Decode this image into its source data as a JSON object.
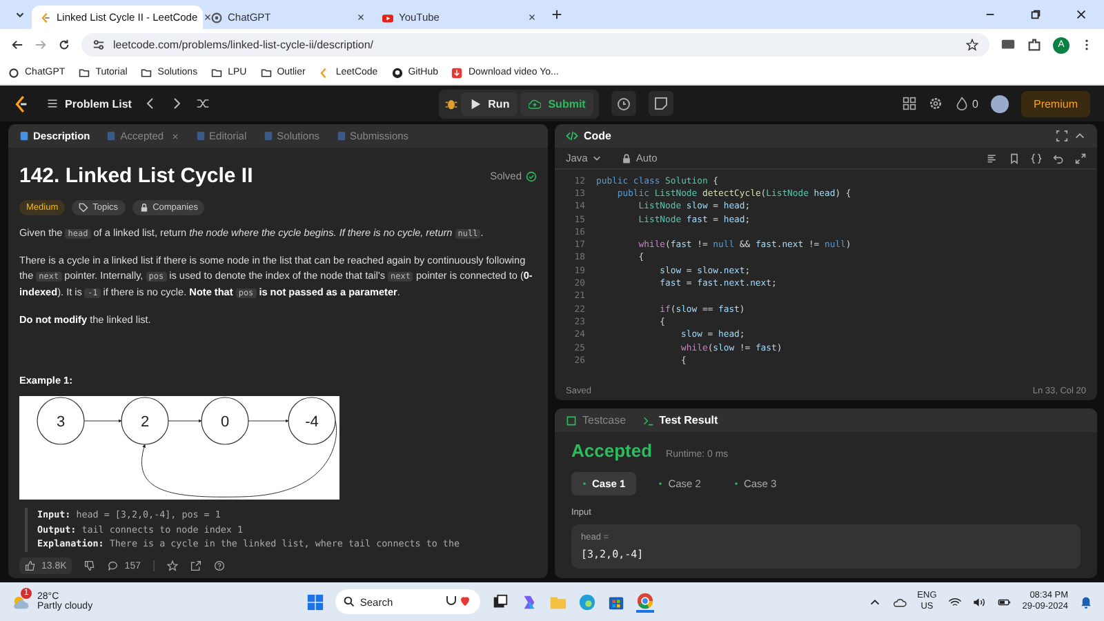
{
  "browser": {
    "tabs": [
      {
        "title": "Linked List Cycle II - LeetCode",
        "kind": "leetcode",
        "selected": true
      },
      {
        "title": "ChatGPT",
        "kind": "chatgpt",
        "selected": false
      },
      {
        "title": "YouTube",
        "kind": "youtube",
        "selected": false
      }
    ],
    "url": "leetcode.com/problems/linked-list-cycle-ii/description/",
    "profile_initial": "A",
    "bookmarks": [
      {
        "label": "ChatGPT",
        "kind": "chatgpt"
      },
      {
        "label": "Tutorial",
        "kind": "folder"
      },
      {
        "label": "Solutions",
        "kind": "folder"
      },
      {
        "label": "LPU",
        "kind": "folder"
      },
      {
        "label": "Outlier",
        "kind": "folder"
      },
      {
        "label": "LeetCode",
        "kind": "leetcode"
      },
      {
        "label": "GitHub",
        "kind": "github"
      },
      {
        "label": "Download video Yo...",
        "kind": "download"
      }
    ]
  },
  "nav": {
    "problem_list": "Problem List",
    "run": "Run",
    "submit": "Submit",
    "streak": "0",
    "premium": "Premium"
  },
  "description_panel": {
    "tabs": [
      {
        "label": "Description",
        "selected": true,
        "closable": false
      },
      {
        "label": "Accepted",
        "selected": false,
        "closable": true
      },
      {
        "label": "Editorial",
        "selected": false,
        "closable": false
      },
      {
        "label": "Solutions",
        "selected": false,
        "closable": false
      },
      {
        "label": "Submissions",
        "selected": false,
        "closable": false
      }
    ],
    "title": "142. Linked List Cycle II",
    "status": "Solved",
    "tags": [
      {
        "label": "Medium",
        "kind": "difficulty"
      },
      {
        "label": "Topics",
        "kind": "topics"
      },
      {
        "label": "Companies",
        "kind": "companies"
      }
    ],
    "paragraphs": [
      [
        {
          "text": "Given the ",
          "kind": "plain"
        },
        {
          "text": "head",
          "kind": "code"
        },
        {
          "text": " of a linked list, return ",
          "kind": "plain"
        },
        {
          "text": "the node where the cycle begins. If there is no cycle, return ",
          "kind": "italic"
        },
        {
          "text": "null",
          "kind": "code"
        },
        {
          "text": ".",
          "kind": "plain"
        }
      ],
      [
        {
          "text": "There is a cycle in a linked list if there is some node in the list that can be reached again by continuously following the ",
          "kind": "plain"
        },
        {
          "text": "next",
          "kind": "code"
        },
        {
          "text": " pointer. Internally, ",
          "kind": "plain"
        },
        {
          "text": "pos",
          "kind": "code"
        },
        {
          "text": " is used to denote the index of the node that tail's ",
          "kind": "plain"
        },
        {
          "text": "next",
          "kind": "code"
        },
        {
          "text": " pointer is connected to (",
          "kind": "plain"
        },
        {
          "text": "0-indexed",
          "kind": "bold"
        },
        {
          "text": "). It is ",
          "kind": "plain"
        },
        {
          "text": "-1",
          "kind": "code"
        },
        {
          "text": " if there is no cycle. ",
          "kind": "plain"
        },
        {
          "text": "Note that ",
          "kind": "bold"
        },
        {
          "text": "pos",
          "kind": "code"
        },
        {
          "text": " is not passed as a parameter",
          "kind": "bold"
        },
        {
          "text": ".",
          "kind": "plain"
        }
      ],
      [
        {
          "text": "Do not modify",
          "kind": "bold"
        },
        {
          "text": " the linked list.",
          "kind": "plain"
        }
      ]
    ],
    "example_title": "Example 1:",
    "diagram": {
      "nodes": [
        "3",
        "2",
        "0",
        "-4"
      ]
    },
    "example_lines": [
      {
        "label": "Input:",
        "text": "head = [3,2,0,-4], pos = 1"
      },
      {
        "label": "Output:",
        "text": "tail connects to node index 1"
      },
      {
        "label": "Explanation:",
        "text": "There is a cycle in the linked list, where tail connects to the"
      }
    ],
    "likes": "13.8K",
    "comments": "157"
  },
  "code_panel": {
    "title": "Code",
    "language": "Java",
    "mode": "Auto",
    "status": "Saved",
    "cursor": "Ln 33, Col 20",
    "lines": [
      {
        "n": "12",
        "tokens": [
          {
            "text": "public class ",
            "kind": "kw"
          },
          {
            "text": "Solution",
            "kind": "type"
          },
          {
            "text": " {",
            "kind": "plain"
          }
        ]
      },
      {
        "n": "13",
        "tokens": [
          {
            "text": "    public ",
            "kind": "kw"
          },
          {
            "text": "ListNode ",
            "kind": "type"
          },
          {
            "text": "detectCycle",
            "kind": "fn"
          },
          {
            "text": "(",
            "kind": "plain"
          },
          {
            "text": "ListNode ",
            "kind": "type"
          },
          {
            "text": "head",
            "kind": "var"
          },
          {
            "text": ") {",
            "kind": "plain"
          }
        ]
      },
      {
        "n": "14",
        "tokens": [
          {
            "text": "        ListNode ",
            "kind": "type"
          },
          {
            "text": "slow",
            "kind": "var"
          },
          {
            "text": " = ",
            "kind": "plain"
          },
          {
            "text": "head",
            "kind": "var"
          },
          {
            "text": ";",
            "kind": "plain"
          }
        ]
      },
      {
        "n": "15",
        "tokens": [
          {
            "text": "        ListNode ",
            "kind": "type"
          },
          {
            "text": "fast",
            "kind": "var"
          },
          {
            "text": " = ",
            "kind": "plain"
          },
          {
            "text": "head",
            "kind": "var"
          },
          {
            "text": ";",
            "kind": "plain"
          }
        ]
      },
      {
        "n": "16"
      },
      {
        "n": "17",
        "tokens": [
          {
            "text": "        while",
            "kind": "ctl"
          },
          {
            "text": "(",
            "kind": "plain"
          },
          {
            "text": "fast",
            "kind": "var"
          },
          {
            "text": " != ",
            "kind": "plain"
          },
          {
            "text": "null",
            "kind": "kw"
          },
          {
            "text": " && ",
            "kind": "plain"
          },
          {
            "text": "fast.next",
            "kind": "var"
          },
          {
            "text": " != ",
            "kind": "plain"
          },
          {
            "text": "null",
            "kind": "kw"
          },
          {
            "text": ")",
            "kind": "plain"
          }
        ]
      },
      {
        "n": "18",
        "tokens": [
          {
            "text": "        {",
            "kind": "plain"
          }
        ]
      },
      {
        "n": "19",
        "tokens": [
          {
            "text": "            slow",
            "kind": "var"
          },
          {
            "text": " = ",
            "kind": "plain"
          },
          {
            "text": "slow.next",
            "kind": "var"
          },
          {
            "text": ";",
            "kind": "plain"
          }
        ]
      },
      {
        "n": "20",
        "tokens": [
          {
            "text": "            fast",
            "kind": "var"
          },
          {
            "text": " = ",
            "kind": "plain"
          },
          {
            "text": "fast.next.next",
            "kind": "var"
          },
          {
            "text": ";",
            "kind": "plain"
          }
        ]
      },
      {
        "n": "21"
      },
      {
        "n": "22",
        "tokens": [
          {
            "text": "            if",
            "kind": "ctl"
          },
          {
            "text": "(",
            "kind": "plain"
          },
          {
            "text": "slow",
            "kind": "var"
          },
          {
            "text": " == ",
            "kind": "plain"
          },
          {
            "text": "fast",
            "kind": "var"
          },
          {
            "text": ")",
            "kind": "plain"
          }
        ]
      },
      {
        "n": "23",
        "tokens": [
          {
            "text": "            {",
            "kind": "plain"
          }
        ]
      },
      {
        "n": "24",
        "tokens": [
          {
            "text": "                slow",
            "kind": "var"
          },
          {
            "text": " = ",
            "kind": "plain"
          },
          {
            "text": "head",
            "kind": "var"
          },
          {
            "text": ";",
            "kind": "plain"
          }
        ]
      },
      {
        "n": "25",
        "tokens": [
          {
            "text": "                while",
            "kind": "ctl"
          },
          {
            "text": "(",
            "kind": "plain"
          },
          {
            "text": "slow",
            "kind": "var"
          },
          {
            "text": " != ",
            "kind": "plain"
          },
          {
            "text": "fast",
            "kind": "var"
          },
          {
            "text": ")",
            "kind": "plain"
          }
        ]
      },
      {
        "n": "26",
        "tokens": [
          {
            "text": "                {",
            "kind": "plain"
          }
        ]
      }
    ]
  },
  "result_panel": {
    "tabs": [
      {
        "label": "Testcase",
        "selected": false
      },
      {
        "label": "Test Result",
        "selected": true
      }
    ],
    "verdict": "Accepted",
    "runtime": "Runtime: 0 ms",
    "cases": [
      {
        "label": "Case 1",
        "selected": true
      },
      {
        "label": "Case 2",
        "selected": false
      },
      {
        "label": "Case 3",
        "selected": false
      }
    ],
    "input_label": "Input",
    "param": "head =",
    "value": "[3,2,0,-4]"
  },
  "taskbar": {
    "weather_badge": "1",
    "temperature": "28°C",
    "condition": "Partly cloudy",
    "search_placeholder": "Search",
    "language": "ENG",
    "region": "US",
    "time": "08:34 PM",
    "date": "29-09-2024"
  }
}
